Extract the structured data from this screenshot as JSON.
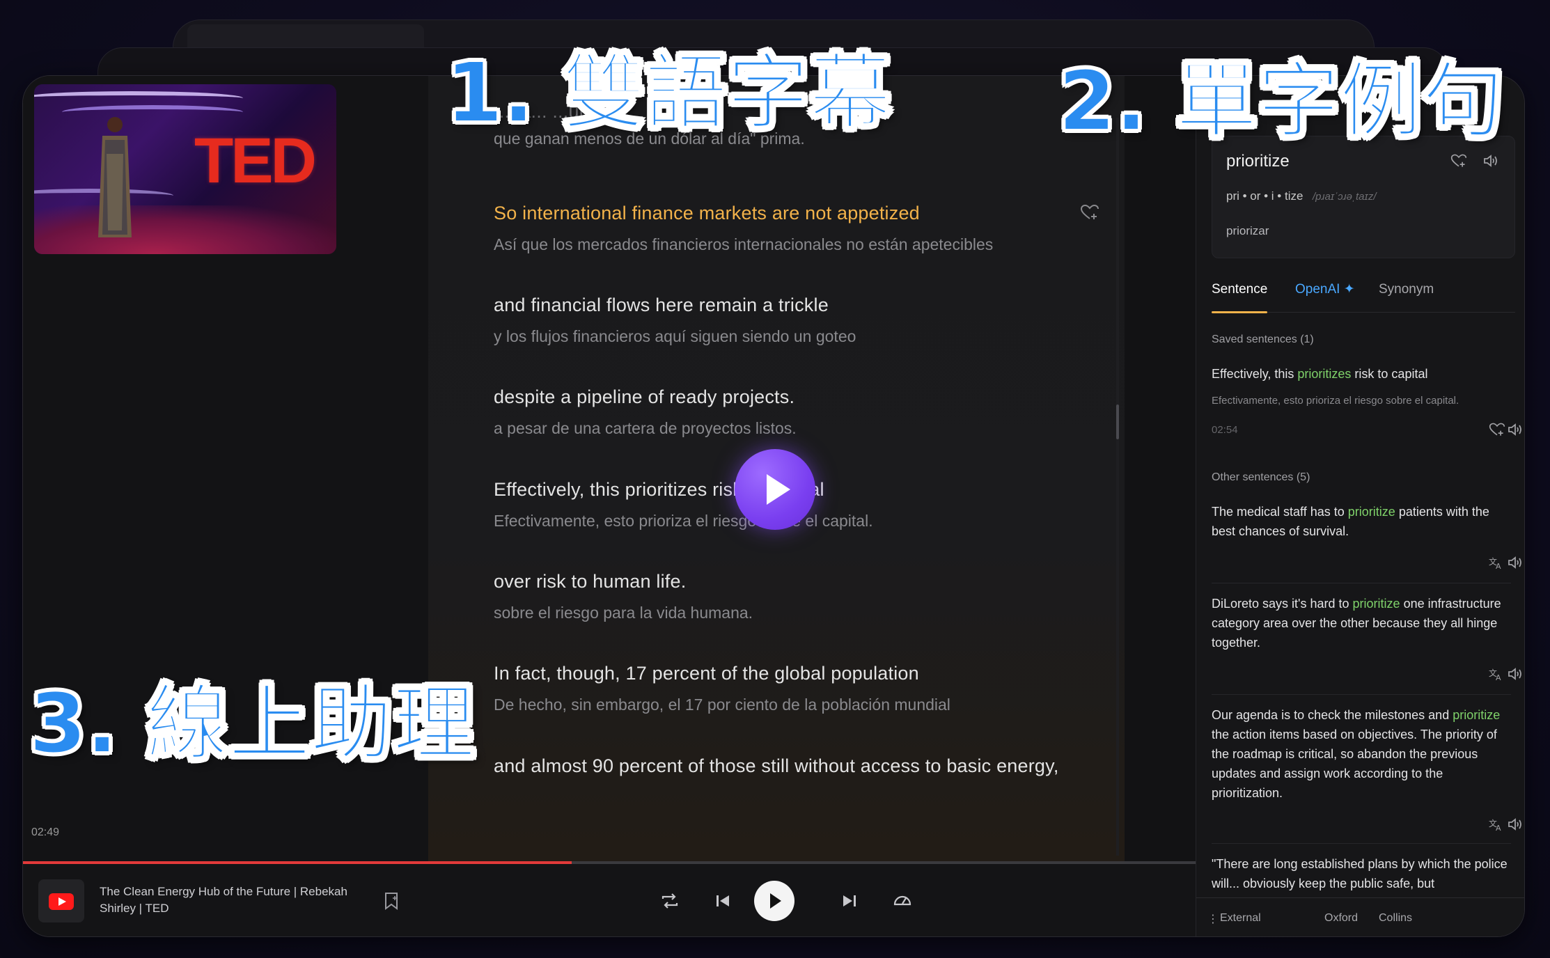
{
  "video": {
    "brand_text": "TED",
    "current_time": "02:49",
    "progress_fraction": 0.468
  },
  "transcript": {
    "top_fragment_en": "...ea...                      ...um.",
    "lines": [
      {
        "en": "",
        "es": "que ganan menos de un dólar al día\" prima.",
        "state": "dim"
      },
      {
        "en": "So international finance markets are not appetized",
        "es": "Así que los mercados financieros internacionales no están apetecibles",
        "state": "active"
      },
      {
        "en": "and financial flows here remain a trickle",
        "es": "y los flujos financieros aquí siguen siendo un goteo",
        "state": "normal"
      },
      {
        "en": "despite a pipeline of ready projects.",
        "es": "a pesar de una cartera de proyectos listos.",
        "state": "normal"
      },
      {
        "en": "Effectively, this prioritizes risk to capital",
        "es": "Efectivamente, esto prioriza el riesgo sobre el capital.",
        "state": "normal"
      },
      {
        "en": "over risk to human life.",
        "es": "sobre el riesgo para la vida humana.",
        "state": "normal"
      },
      {
        "en": "In fact, though, 17 percent of the global population",
        "es": "De hecho, sin embargo, el 17 por ciento de la población mundial",
        "state": "normal"
      },
      {
        "en": "and almost 90 percent of those still without access to basic energy,",
        "es": "",
        "state": "normal"
      }
    ]
  },
  "word_card": {
    "word": "prioritize",
    "syllables": "pri • or • i • tize",
    "ipa": "/pɹaɪˈɔɹəˌtaɪz/",
    "translation": "priorizar"
  },
  "tabs": [
    {
      "label": "Sentence",
      "active": true
    },
    {
      "label": "OpenAI ✦",
      "active": false
    },
    {
      "label": "Synonym",
      "active": false
    }
  ],
  "saved": {
    "label": "Saved sentences (1)",
    "sentence_pre": "Effectively, this ",
    "sentence_hl": "prioritizes",
    "sentence_post": " risk to capital",
    "translation": "Efectivamente, esto prioriza el riesgo sobre el capital.",
    "time": "02:54"
  },
  "other": {
    "label": "Other sentences (5)",
    "items": [
      {
        "pre": "The medical staff has to ",
        "hl": "prioritize",
        "post": " patients with the best chances of survival."
      },
      {
        "pre": "DiLoreto says it's hard to ",
        "hl": "prioritize",
        "post": " one infrastructure category area over the other because they all hinge together."
      },
      {
        "pre": "Our agenda is to check the milestones and ",
        "hl": "prioritize",
        "post": " the action items based on objectives. The priority of the roadmap is critical, so abandon the previous updates and assign work according to the prioritization."
      },
      {
        "pre": "\"There are long established plans by which the police will... obviously keep the public safe, but",
        "hl": "",
        "post": ""
      }
    ]
  },
  "footer": {
    "external": "External",
    "oxford": "Oxford",
    "collins": "Collins"
  },
  "now_playing": {
    "title": "The Clean Energy Hub of the Future | Rebekah Shirley | TED"
  },
  "captions": {
    "c1": "1. 雙語字幕",
    "c2": "2. 單字例句",
    "c3": "3. 線上助理"
  },
  "colors": {
    "accent_orange": "#f2b24a",
    "highlight_green": "#7fd26a",
    "openai_blue": "#4aa8ff",
    "progress_red": "#e23a3a",
    "play_purple": "#7a3ff0",
    "caption_blue": "#2a8cf0"
  },
  "icons": [
    "heart-plus-icon",
    "volume-icon",
    "translate-icon",
    "bookmark-icon",
    "repeat-icon",
    "skip-back-icon",
    "play-icon",
    "skip-forward-icon",
    "speed-icon",
    "youtube-icon",
    "more-vertical-icon"
  ]
}
